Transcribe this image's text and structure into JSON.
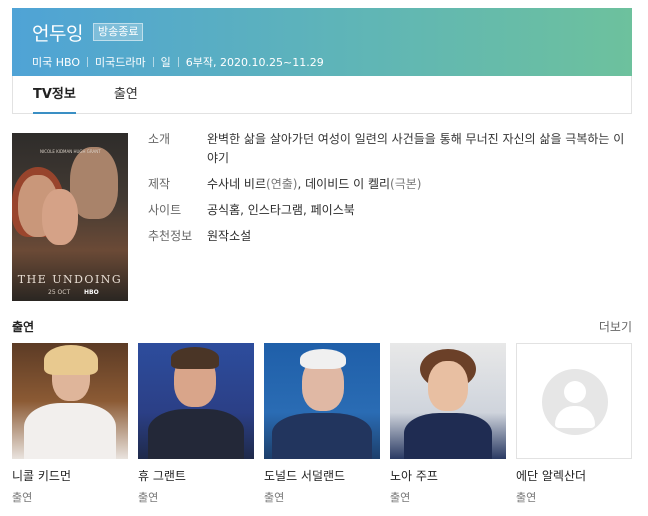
{
  "header": {
    "title": "언두잉",
    "status_badge": "방송종료",
    "meta": [
      "미국 HBO",
      "미국드라마",
      "일",
      "6부작, 2020.10.25~11.29"
    ]
  },
  "tabs": [
    {
      "label": "TV정보",
      "active": true
    },
    {
      "label": "출연",
      "active": false
    }
  ],
  "poster": {
    "title_text": "THE UNDOING",
    "date_text": "25 OCT",
    "network_text": "HBO",
    "cast_text": "NICOLE KIDMAN   HUGH GRANT"
  },
  "info": {
    "synopsis_label": "소개",
    "synopsis": "완벽한 삶을 살아가던 여성이 일련의 사건들을 통해 무너진 자신의 삶을 극복하는 이야기",
    "production_label": "제작",
    "director_name": "수사네 비르",
    "director_role": "(연출)",
    "writer_name": "데이비드 이 켈리",
    "writer_role": "(극본)",
    "site_label": "사이트",
    "sites": [
      "공식홈",
      "인스타그램",
      "페이스북"
    ],
    "recommend_label": "추천정보",
    "recommend": "원작소설"
  },
  "cast_section": {
    "title": "출연",
    "more_label": "더보기",
    "members": [
      {
        "name": "니콜 키드먼",
        "role": "출연"
      },
      {
        "name": "휴 그랜트",
        "role": "출연"
      },
      {
        "name": "도널드 서덜랜드",
        "role": "출연"
      },
      {
        "name": "노아 주프",
        "role": "출연"
      },
      {
        "name": "에단 알렉산더",
        "role": "출연"
      }
    ]
  },
  "colors": {
    "header_gradient_start": "#4fa3d6",
    "header_gradient_end": "#6dc19d",
    "tab_underline": "#3a8fc4"
  }
}
